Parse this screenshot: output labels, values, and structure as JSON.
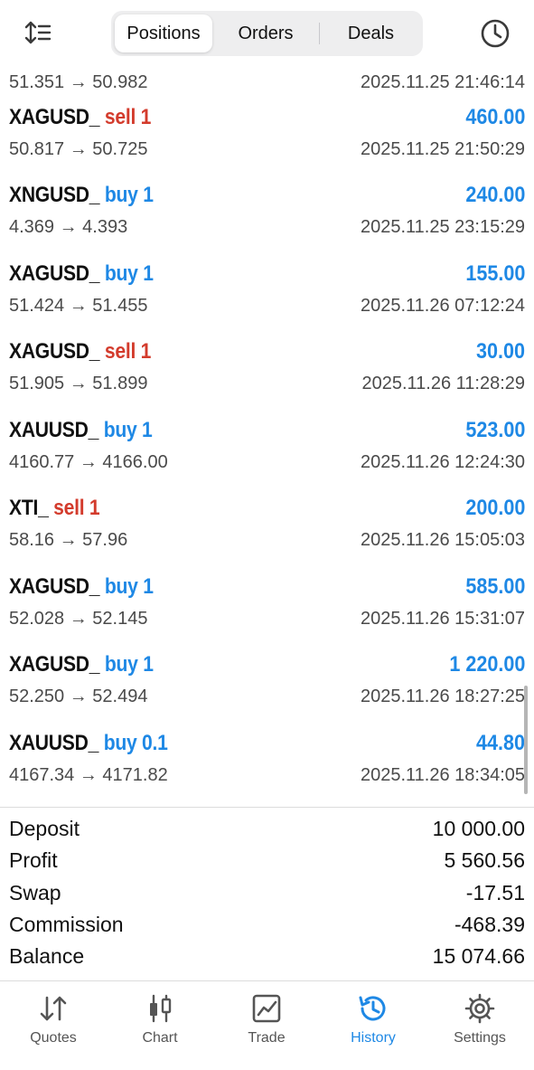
{
  "header": {
    "tabs": [
      {
        "label": "Positions",
        "active": true
      },
      {
        "label": "Orders",
        "active": false
      },
      {
        "label": "Deals",
        "active": false
      }
    ],
    "icons": {
      "sort": "sort-icon",
      "history": "clock-icon"
    }
  },
  "partial_row": {
    "prices": "51.351 → 50.982",
    "time": "2025.11.25 21:46:14"
  },
  "deals": [
    {
      "symbol": "XAGUSD_",
      "direction": "sell",
      "direction_label": "sell 1",
      "profit": "460.00",
      "prices": "50.817 → 50.725",
      "time": "2025.11.25 21:50:29"
    },
    {
      "symbol": "XNGUSD_",
      "direction": "buy",
      "direction_label": "buy 1",
      "profit": "240.00",
      "prices": "4.369 → 4.393",
      "time": "2025.11.25 23:15:29"
    },
    {
      "symbol": "XAGUSD_",
      "direction": "buy",
      "direction_label": "buy 1",
      "profit": "155.00",
      "prices": "51.424 → 51.455",
      "time": "2025.11.26 07:12:24"
    },
    {
      "symbol": "XAGUSD_",
      "direction": "sell",
      "direction_label": "sell 1",
      "profit": "30.00",
      "prices": "51.905 → 51.899",
      "time": "2025.11.26 11:28:29"
    },
    {
      "symbol": "XAUUSD_",
      "direction": "buy",
      "direction_label": "buy 1",
      "profit": "523.00",
      "prices": "4160.77 → 4166.00",
      "time": "2025.11.26 12:24:30"
    },
    {
      "symbol": "XTI_",
      "direction": "sell",
      "direction_label": "sell 1",
      "profit": "200.00",
      "prices": "58.16 → 57.96",
      "time": "2025.11.26 15:05:03"
    },
    {
      "symbol": "XAGUSD_",
      "direction": "buy",
      "direction_label": "buy 1",
      "profit": "585.00",
      "prices": "52.028 → 52.145",
      "time": "2025.11.26 15:31:07"
    },
    {
      "symbol": "XAGUSD_",
      "direction": "buy",
      "direction_label": "buy 1",
      "profit": "1 220.00",
      "prices": "52.250 → 52.494",
      "time": "2025.11.26 18:27:25"
    },
    {
      "symbol": "XAUUSD_",
      "direction": "buy",
      "direction_label": "buy 0.1",
      "profit": "44.80",
      "prices": "4167.34 → 4171.82",
      "time": "2025.11.26 18:34:05"
    }
  ],
  "summary": [
    {
      "label": "Deposit",
      "value": "10 000.00"
    },
    {
      "label": "Profit",
      "value": "5 560.56"
    },
    {
      "label": "Swap",
      "value": "-17.51"
    },
    {
      "label": "Commission",
      "value": "-468.39"
    },
    {
      "label": "Balance",
      "value": "15 074.66"
    }
  ],
  "tabbar": [
    {
      "label": "Quotes",
      "icon": "quotes-icon",
      "active": false
    },
    {
      "label": "Chart",
      "icon": "candlestick-chart-icon",
      "active": false
    },
    {
      "label": "Trade",
      "icon": "trade-chart-icon",
      "active": false
    },
    {
      "label": "History",
      "icon": "history-icon",
      "active": true
    },
    {
      "label": "Settings",
      "icon": "gear-icon",
      "active": false
    }
  ],
  "colors": {
    "accent": "#1e88e5",
    "sell": "#d33b2c",
    "buy": "#1e88e5",
    "text": "#111111",
    "muted": "#4a4a4a"
  }
}
